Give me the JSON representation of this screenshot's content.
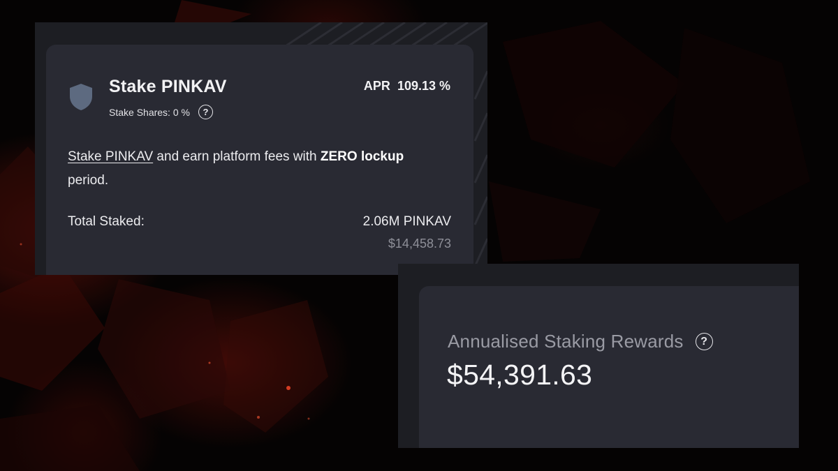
{
  "colors": {
    "page_background": "#050303",
    "ember_red": "#961610",
    "panel": "#1d1e23",
    "card": "#292a33",
    "text_primary": "#f2f2f4",
    "text_muted": "#8e8f98",
    "shield": "#5d6a80"
  },
  "stake_card": {
    "icon": "shield-icon",
    "title": "Stake PINKAV",
    "shares_label": "Stake Shares: 0 %",
    "help_icon": "help-circle-icon",
    "apr_label": "APR",
    "apr_value": "109.13 %",
    "description": {
      "link_text": "Stake PINKAV",
      "text_1": " and earn platform fees with ",
      "bold_1": "ZERO",
      "text_2": " ",
      "bold_2": "lockup",
      "text_3": " period."
    },
    "total_staked_label": "Total Staked:",
    "total_staked_amount": "2.06M PINKAV",
    "total_staked_usd": "$14,458.73"
  },
  "rewards_card": {
    "label": "Annualised Staking Rewards",
    "help_icon": "help-circle-icon",
    "value": "$54,391.63"
  }
}
